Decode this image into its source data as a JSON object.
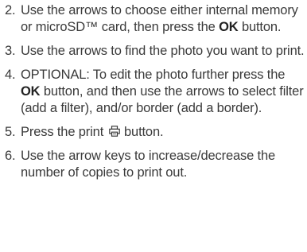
{
  "steps": [
    {
      "number": "2.",
      "text_before": "Use the arrows to choose either internal memory or microSD™ card, then press the ",
      "bold": "OK",
      "text_after": " button."
    },
    {
      "number": "3.",
      "text": "Use the arrows to find the photo you want to print."
    },
    {
      "number": "4.",
      "text_before": "OPTIONAL: To edit the photo further press the ",
      "bold": "OK",
      "text_after": " button, and then use the arrows to select filter (add a filter), and/or border (add a border)."
    },
    {
      "number": "5.",
      "text_before": "Press the print ",
      "icon": "print-icon",
      "text_after": " button."
    },
    {
      "number": "6.",
      "text": "Use the arrow keys to increase/decrease the number of copies to print out."
    }
  ]
}
